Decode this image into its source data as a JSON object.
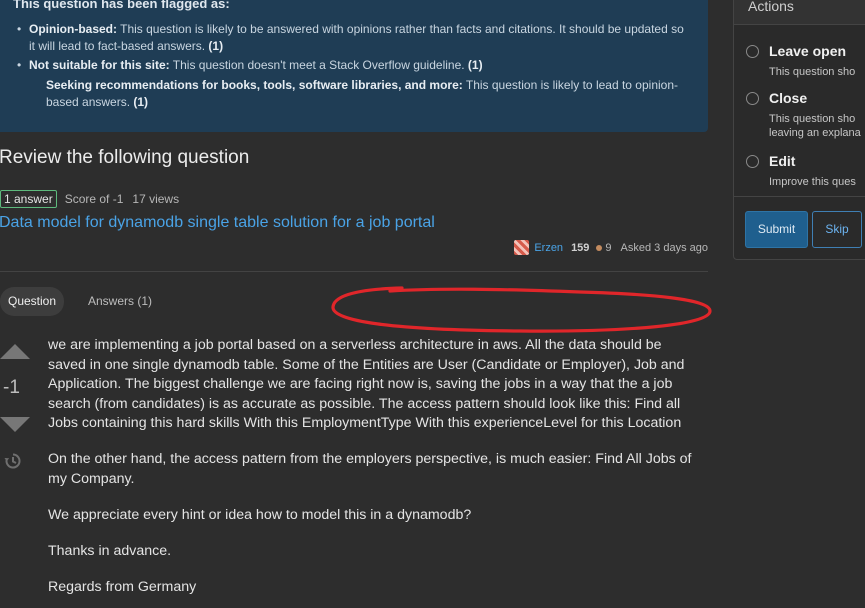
{
  "flag": {
    "title": "This question has been flagged as:",
    "items": [
      {
        "label": "Opinion-based:",
        "text": " This question is likely to be answered with opinions rather than facts and citations. It should be updated so it will lead to fact-based answers. ",
        "count": "(1)"
      },
      {
        "label": "Not suitable for this site:",
        "text": " This question doesn't meet a Stack Overflow guideline. ",
        "count": "(1)"
      }
    ],
    "sub": {
      "label": "Seeking recommendations for books, tools, software libraries, and more:",
      "text": " This question is likely to lead to opinion-based answers. ",
      "count": "(1)"
    }
  },
  "review": {
    "heading": "Review the following question",
    "answers_badge": "1 answer",
    "score": "Score of -1",
    "views": "17 views",
    "question_title": "Data model for dynamodb single table solution for a job portal"
  },
  "user": {
    "name": "Erzen",
    "reputation": "159",
    "bronze": "9",
    "asked": "Asked 3 days ago"
  },
  "tabs": {
    "question": "Question",
    "answers": "Answers (1)"
  },
  "vote": {
    "count": "-1"
  },
  "post": {
    "paragraphs": [
      "we are implementing a job portal based on a serverless architecture in aws. All the data should be saved in one single dynamodb table. Some of the Entities are User (Candidate or Employer), Job and Application. The biggest challenge we are facing right now is, saving the jobs in a way that the a job search (from candidates) is as accurate as possible. The access pattern should look like this: Find all Jobs containing this hard skills With this EmploymentType With this experienceLevel for this Location",
      "On the other hand, the access pattern from the employers perspective, is much easier: Find All Jobs of my Company.",
      "We appreciate every hint or idea how to model this in a dynamodb?",
      "Thanks in advance.",
      "Regards from Germany"
    ]
  },
  "actions": {
    "heading": "Actions",
    "options": [
      {
        "label": "Leave open",
        "desc": [
          "This question sho"
        ]
      },
      {
        "label": "Close",
        "desc": [
          "This question sho",
          "leaving an explana"
        ]
      },
      {
        "label": "Edit",
        "desc": [
          "Improve this ques"
        ]
      }
    ],
    "submit": "Submit",
    "skip": "Skip"
  },
  "colors": {
    "banner": "#1f3d55",
    "link": "#4aa3e6",
    "annotation": "#e0262a",
    "accepted_green": "#5eba7d"
  }
}
